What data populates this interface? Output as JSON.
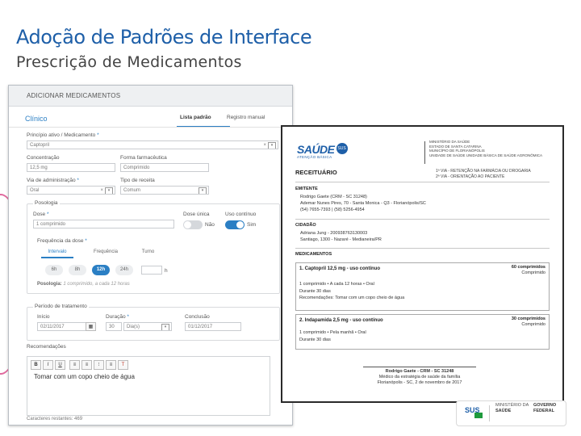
{
  "slide": {
    "title": "Adoção de Padrões de Interface",
    "subtitle": "Prescrição de Medicamentos"
  },
  "form": {
    "header": "ADICIONAR MEDICAMENTOS",
    "section": "Clínico",
    "tabs": [
      {
        "label": "Lista padrão",
        "active": true
      },
      {
        "label": "Registro manual",
        "active": false
      }
    ],
    "principio_label": "Princípio ativo / Medicamento",
    "principio_value": "Captopril",
    "concentracao_label": "Concentração",
    "concentracao_value": "12,5 mg",
    "forma_label": "Forma farmacêutica",
    "forma_value": "Comprimido",
    "via_label": "Via de administração",
    "via_value": "Oral",
    "tipo_receita_label": "Tipo de receita",
    "tipo_receita_value": "Comum",
    "posologia_title": "Posologia",
    "dose_label": "Dose",
    "dose_value": "1 comprimido",
    "dose_unica_label": "Dose única",
    "dose_unica_value": "Não",
    "uso_continuo_label": "Uso contínuo",
    "uso_continuo_value": "Sim",
    "frequencia_label": "Frequência da dose",
    "freq_options": [
      "Intervalo",
      "Frequência",
      "Turno"
    ],
    "interval_options": [
      "6h",
      "8h",
      "12h",
      "24h"
    ],
    "interval_selected": "12h",
    "interval_unit": "h",
    "posologia_hint_label": "Posologia:",
    "posologia_hint": "1 comprimido, a cada 12 horas",
    "periodo_title": "Período de tratamento",
    "inicio_label": "Início",
    "inicio_value": "02/11/2017",
    "duracao_label": "Duração",
    "duracao_value": "30",
    "duracao_unit": "Dia(s)",
    "conclusao_label": "Conclusão",
    "conclusao_value": "01/12/2017",
    "recomendacoes_label": "Recomendações",
    "toolbar": [
      "B",
      "I",
      "U",
      "≡",
      "≡",
      "⁝",
      "≡",
      "T"
    ],
    "recomendacoes_text": "Tomar com um copo cheio de água",
    "char_count": "Caracteres restantes: 469"
  },
  "receipt": {
    "logo_text": "SAÚDE",
    "logo_badge": "SUS",
    "logo_sub": "ATENÇÃO BÁSICA",
    "header_lines": [
      "MINISTÉRIO DA SAÚDE",
      "ESTADO DE SANTA CATARINA",
      "MUNICÍPIO DE FLORIANÓPOLIS",
      "UNIDADE DE SAÚDE UNIDADE BÁSICA DE SAÚDE AGRONÔMICA"
    ],
    "title": "RECEITUÁRIO",
    "vias": [
      "1ª VIA - RETENÇÃO NA FARMÁCIA OU DROGARIA",
      "2ª VIA - ORIENTAÇÃO AO PACIENTE"
    ],
    "emitente_label": "EMITENTE",
    "emitente_lines": [
      "Rodrigo Gaete (CRM - SC 31248)",
      "Ademar Nunes Pires, 70 - Santa Monica - Q3 - Florianópolis/SC",
      "(54) 7655-7393  |  (58) 5256-4954"
    ],
    "cidadao_label": "CIDADÃO",
    "cidadao_lines": [
      "Adriana Jung - 200938763130003",
      "Santiago, 1300 - Nazaré - Medianeira/PR"
    ],
    "medicamentos_label": "MEDICAMENTOS",
    "meds": [
      {
        "title": "1. Captopril 12,5 mg - uso contínuo",
        "qty": "60 comprimidos",
        "form": "Comprimido",
        "lines": [
          "1 comprimido • A cada 12 horas • Oral",
          "Durante 30 dias",
          "Recomendações: Tomar com um copo cheio de água"
        ]
      },
      {
        "title": "2. Indapamida 2,5 mg - uso contínuo",
        "qty": "30 comprimidos",
        "form": "Comprimido",
        "lines": [
          "1 comprimido • Pela manhã • Oral",
          "Durante 30 dias"
        ]
      }
    ],
    "signature_lines": [
      "Rodrigo Gaete - CRM - SC 31248",
      "Médico da estratégia de saúde da família",
      "Florianópolis - SC, 2 de novembro de 2017"
    ]
  },
  "footer": {
    "sus": "SUS",
    "ministerio": "MINISTÉRIO DA",
    "saude": "SAÚDE",
    "governo": "GOVERNO",
    "federal": "FEDERAL"
  }
}
